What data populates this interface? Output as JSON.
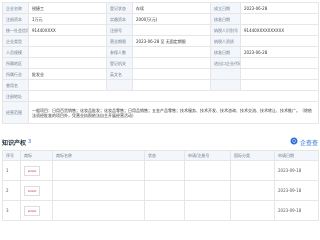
{
  "info": {
    "rows": [
      [
        {
          "t": "企业名称",
          "lbl": true
        },
        {
          "t": "锐捷工",
          "lbl": false
        },
        {
          "t": "登记状态",
          "lbl": true
        },
        {
          "t": "存续",
          "lbl": false
        },
        {
          "t": "成立日期",
          "lbl": true
        },
        {
          "t": "2023-06-28",
          "lbl": false
        }
      ],
      [
        {
          "t": "注册资本",
          "lbl": true
        },
        {
          "t": "1万元",
          "lbl": false
        },
        {
          "t": "实缴资本",
          "lbl": true
        },
        {
          "t": "2000万(元)",
          "lbl": false
        },
        {
          "t": "核准日期",
          "lbl": true
        },
        {
          "t": "",
          "lbl": false
        }
      ],
      [
        {
          "t": "统一社会信用代码",
          "lbl": true
        },
        {
          "t": "91440XXXX",
          "lbl": false
        },
        {
          "t": "注册号",
          "lbl": true
        },
        {
          "t": "",
          "lbl": false
        },
        {
          "t": "纳税人识别号",
          "lbl": true
        },
        {
          "t": "91440XXXXXXXXXX",
          "lbl": false
        }
      ],
      [
        {
          "t": "企业类型",
          "lbl": true
        },
        {
          "t": "",
          "lbl": false
        },
        {
          "t": "营业期限",
          "lbl": true
        },
        {
          "t": "2023-06-28 至 无固定期限",
          "lbl": false
        },
        {
          "t": "纳税人资质",
          "lbl": true
        },
        {
          "t": "",
          "lbl": false
        }
      ],
      [
        {
          "t": "人员规模",
          "lbl": true
        },
        {
          "t": "",
          "lbl": false
        },
        {
          "t": "参保人数",
          "lbl": true
        },
        {
          "t": "",
          "lbl": false
        },
        {
          "t": "核准日期",
          "lbl": true
        },
        {
          "t": "2023-06-28",
          "lbl": false
        }
      ],
      [
        {
          "t": "所属地区",
          "lbl": true
        },
        {
          "t": "",
          "lbl": false
        },
        {
          "t": "登记机关",
          "lbl": true
        },
        {
          "t": "",
          "lbl": false
        },
        {
          "t": "进出口企业代码",
          "lbl": true
        },
        {
          "t": "",
          "lbl": false
        }
      ],
      [
        {
          "t": "所属行业",
          "lbl": true
        },
        {
          "t": "批发业",
          "lbl": false
        },
        {
          "t": "英文名",
          "lbl": true
        },
        {
          "t": "",
          "lbl": false
        },
        {
          "t": "",
          "lbl": true
        },
        {
          "t": "",
          "lbl": false
        }
      ],
      [
        {
          "t": "曾用名",
          "lbl": true
        },
        {
          "t": "",
          "lbl": false
        },
        {
          "t": "",
          "lbl": true
        },
        {
          "t": "",
          "lbl": false
        },
        {
          "t": "",
          "lbl": true
        },
        {
          "t": "",
          "lbl": false
        }
      ]
    ],
    "address_label": "注册地址",
    "address_value": "",
    "scope_label": "经营范围",
    "scope_value": "一般项目：日用百货销售；化妆品批发；化妆品零售；日用品销售；五金产品零售；技术服务、技术开发、技术咨询、技术交流、技术转让、技术推广。（除依法须经批准的项目外，凭营业执照依法自主开展经营活动）"
  },
  "section": {
    "title": "知识产权",
    "count": "3",
    "hint": "",
    "right_label": "企查查"
  },
  "columns": [
    "序号",
    "商标",
    "商标名称",
    "状态",
    "申请/注册号",
    "国际分类",
    "申请日期"
  ],
  "trademarks": [
    {
      "idx": "1",
      "logo": "LOGO",
      "name": "",
      "tags": [
        {
          "t": "",
          "c": "blue"
        },
        {
          "t": "",
          "c": "orange"
        }
      ],
      "status": "",
      "reg": "",
      "cls": "",
      "date": "2023-09-18"
    },
    {
      "idx": "2",
      "logo": "LOGO",
      "name": "",
      "tags": [
        {
          "t": "",
          "c": "blue"
        },
        {
          "t": "",
          "c": "orange"
        }
      ],
      "status": "",
      "reg": "",
      "cls": "",
      "date": "2023-09-18"
    },
    {
      "idx": "3",
      "logo": "LOGO",
      "name": "",
      "tags": [
        {
          "t": "",
          "c": "blue"
        },
        {
          "t": "",
          "c": "orange"
        }
      ],
      "status": "",
      "reg": "",
      "cls": "",
      "date": "2023-09-18"
    }
  ]
}
